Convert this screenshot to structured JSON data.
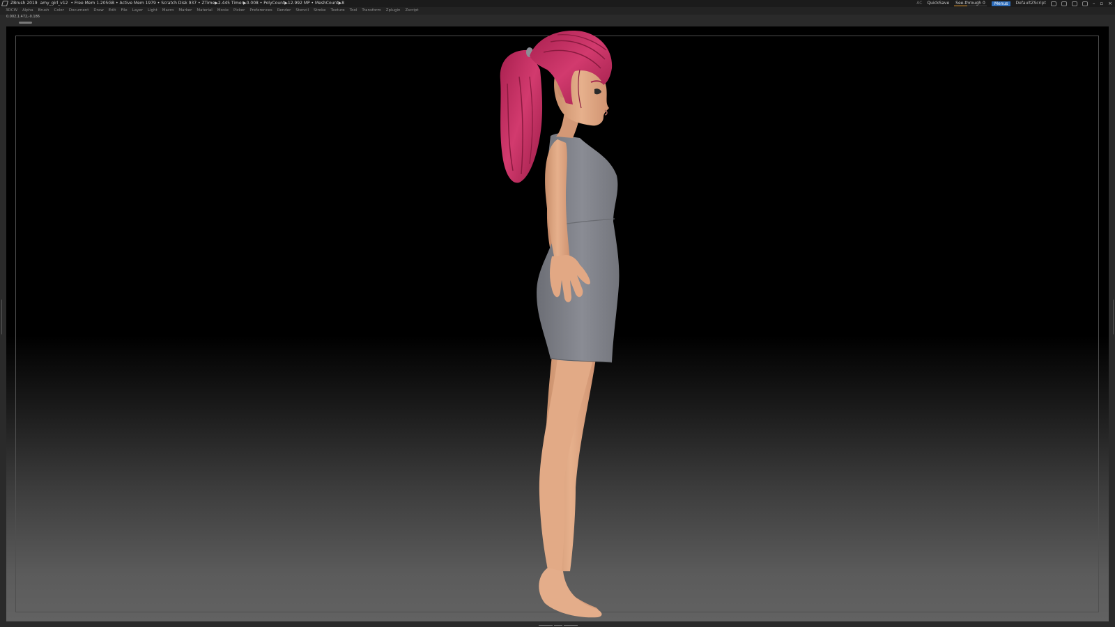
{
  "titlebar": {
    "app_title": "ZBrush 2019",
    "document": "amy_girl_v12",
    "stats": "• Free Mem 1.205GB • Active Mem 1979 • Scratch Disk 937 • ZTime▶2.445 Timer▶0.008 • PolyCount▶12.992 MP • MeshCount▶8",
    "ac_label": "AC",
    "quicksave_label": "QuickSave",
    "see_through_label": "See-through",
    "see_through_value": "0",
    "menus_button": "Menus",
    "script_label": "DefaultZScript"
  },
  "menubar": {
    "items": [
      "3DCW",
      "Alpha",
      "Brush",
      "Color",
      "Document",
      "Draw",
      "Edit",
      "File",
      "Layer",
      "Light",
      "Macro",
      "Marker",
      "Material",
      "Movie",
      "Picker",
      "Preferences",
      "Render",
      "Stencil",
      "Stroke",
      "Texture",
      "Tool",
      "Transform",
      "Zplugin",
      "Zscript"
    ]
  },
  "coords": "0.002,1.472,-0.186",
  "icons": {
    "app": "zbrush-logo-icon",
    "toolbar": [
      "layout-icon",
      "palette-icon",
      "gear-icon",
      "lock-icon"
    ],
    "window": [
      "minimize-icon",
      "maximize-icon",
      "close-icon"
    ]
  },
  "colors": {
    "menu_button": "#2f6fbd",
    "hair": "#c42e62",
    "skin": "#e0a882",
    "dress": "#7c7e86",
    "canvas_top": "#000000",
    "canvas_bottom": "#626262"
  }
}
